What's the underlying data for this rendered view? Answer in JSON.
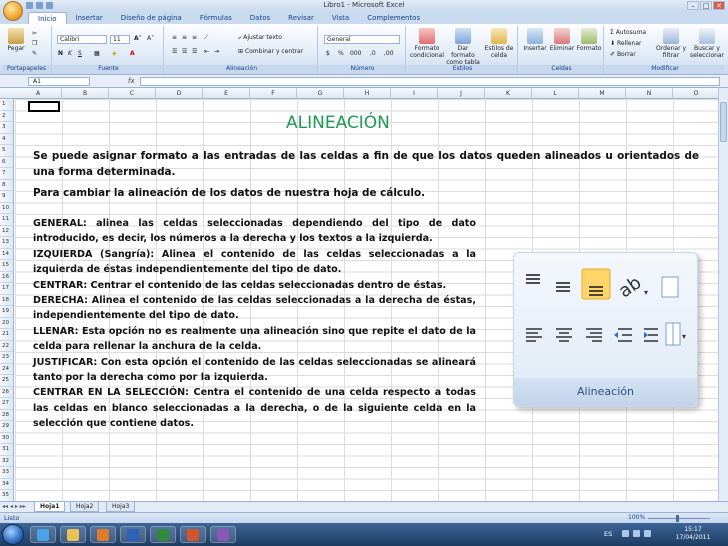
{
  "window": {
    "title": "Libro1 - Microsoft Excel",
    "controls": [
      "–",
      "□",
      "✕"
    ]
  },
  "ribbon_tabs": [
    "Inicio",
    "Insertar",
    "Diseño de página",
    "Fórmulas",
    "Datos",
    "Revisar",
    "Vista",
    "Complementos"
  ],
  "ribbon": {
    "clipboard": {
      "paste": "Pegar",
      "label": "Portapapeles"
    },
    "font": {
      "name": "Calibri",
      "size": "11",
      "label": "Fuente"
    },
    "alignment": {
      "wrap": "Ajustar texto",
      "merge": "Combinar y centrar",
      "label": "Alineación"
    },
    "number": {
      "format": "General",
      "label": "Número"
    },
    "styles": {
      "conditional": "Formato condicional",
      "as_table": "Dar formato como tabla",
      "cell_styles": "Estilos de celda",
      "label": "Estilos"
    },
    "cells": {
      "insert": "Insertar",
      "delete": "Eliminar",
      "format": "Formato",
      "label": "Celdas"
    },
    "editing": {
      "autosum": "Autosuma",
      "fill": "Rellenar",
      "clear": "Borrar",
      "sort": "Ordenar y filtrar",
      "find": "Buscar y seleccionar",
      "label": "Modificar"
    }
  },
  "formula_bar": {
    "name_box": "A1",
    "fx": "fx",
    "value": ""
  },
  "columns": [
    "A",
    "B",
    "C",
    "D",
    "E",
    "F",
    "G",
    "H",
    "I",
    "J",
    "K",
    "L",
    "M",
    "N",
    "O"
  ],
  "rows": [
    "1",
    "2",
    "3",
    "4",
    "5",
    "6",
    "7",
    "8",
    "9",
    "10",
    "11",
    "12",
    "13",
    "14",
    "15",
    "16",
    "17",
    "18",
    "19",
    "20",
    "21",
    "22",
    "23",
    "24",
    "25",
    "26",
    "27",
    "28",
    "29",
    "30",
    "31",
    "32",
    "33",
    "34",
    "35"
  ],
  "content": {
    "heading": "ALINEACIÓN",
    "intro": "Se puede asignar formato a las entradas de las celdas a fin de que los datos queden alineados u orientados de una forma determinada.",
    "intro2": "Para cambiar la alineación de los datos de nuestra hoja de cálculo.",
    "items": [
      "GENERAL: alinea las celdas seleccionadas dependiendo del tipo de dato introducido, es decir, los números a la derecha y los textos a la izquierda.",
      "IZQUIERDA (Sangría): Alinea el contenido de las celdas seleccionadas a la izquierda de éstas independientemente del tipo de dato.",
      "CENTRAR: Centrar el contenido de las celdas seleccionadas dentro de éstas.",
      "DERECHA: Alinea el contenido de las celdas seleccionadas a la derecha de éstas, independientemente del tipo de dato.",
      "LLENAR: Esta opción no es realmente una alineación sino que repite el dato de la celda para rellenar la anchura de la celda.",
      "JUSTIFICAR: Con esta opción el contenido de las celdas seleccionadas se alineará tanto por la derecha como por la izquierda.",
      "CENTRAR EN LA SELECCIÓN: Centra el contenido de una celda respecto a todas las celdas en blanco seleccionadas a la derecha, o de la siguiente celda en la selección que contiene datos."
    ],
    "picture_label": "Alineación"
  },
  "sheets": [
    "Hoja1",
    "Hoja2",
    "Hoja3"
  ],
  "status": {
    "ready": "Listo",
    "zoom": "100%"
  },
  "taskbar": {
    "lang": "ES",
    "time": "15:17",
    "date": "17/04/2011"
  },
  "colors": {
    "heading": "#1e9a56",
    "ribbon": "#dde8f5",
    "highlight": "#ffd56a"
  }
}
